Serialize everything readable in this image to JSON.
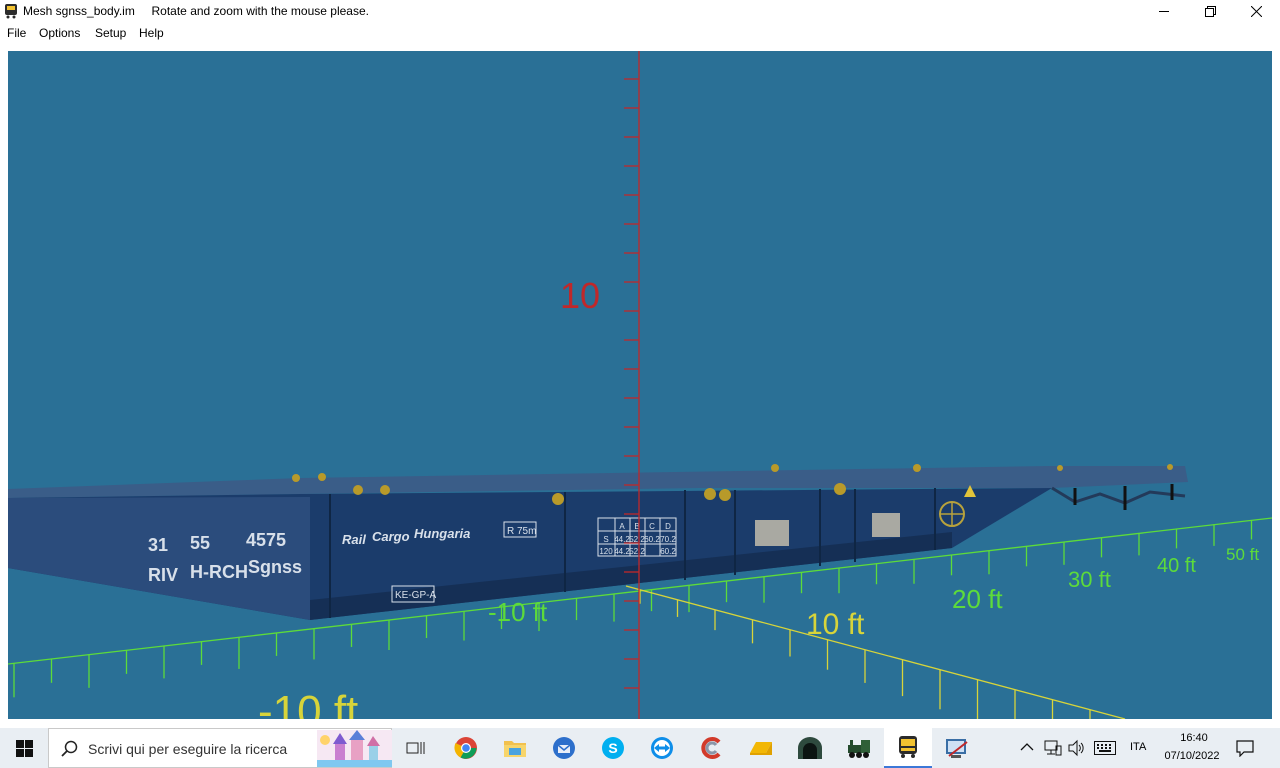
{
  "window": {
    "title": "Mesh sgnss_body.im",
    "hint": "Rotate and zoom with the mouse please."
  },
  "menu": [
    "File",
    "Options",
    "Setup",
    "Help"
  ],
  "viewport": {
    "background": "#2a7096",
    "vertical_axis_label": "10",
    "axis_labels": [
      "-10 ft",
      "10 ft",
      "20 ft",
      "30 ft",
      "40 ft",
      "50 ft",
      "10 ft",
      "-10 ft"
    ],
    "colors": {
      "vertical_axis": "#c0282a",
      "horizontal_axis_green": "#5ddb3a",
      "horizontal_axis_yellow": "#d7d43a",
      "wagon": "#1b3c6b"
    }
  },
  "wagon": {
    "number_row1": [
      "31",
      "55",
      "4575"
    ],
    "number_row2": [
      "RIV",
      "H-RCH",
      "Sgnss"
    ],
    "brand": "Rail Cargo Hungaria",
    "brand_parts": [
      "Rail",
      "Cargo",
      "Hungaria"
    ],
    "tag_r": "R 75m",
    "tag_ke": "KE-GP-A",
    "load_table": {
      "header": [
        "A",
        "B",
        "C",
        "D"
      ],
      "rows": [
        [
          "S",
          "44.2",
          "52.2",
          "60.2",
          "70.2"
        ],
        [
          "120",
          "44.2",
          "52.2",
          "",
          "60.2"
        ]
      ]
    }
  },
  "taskbar": {
    "search_placeholder": "Scrivi qui per eseguire la ricerca",
    "apps": [
      "task-view",
      "chrome",
      "file-explorer",
      "thunderbird",
      "skype",
      "teamviewer",
      "ccleaner",
      "onedrive-folder",
      "tunnel-app",
      "steam-locomotive",
      "bus-app",
      "control-app"
    ],
    "tray": {
      "language": "ITA",
      "time": "16:40",
      "date": "07/10/2022"
    }
  }
}
